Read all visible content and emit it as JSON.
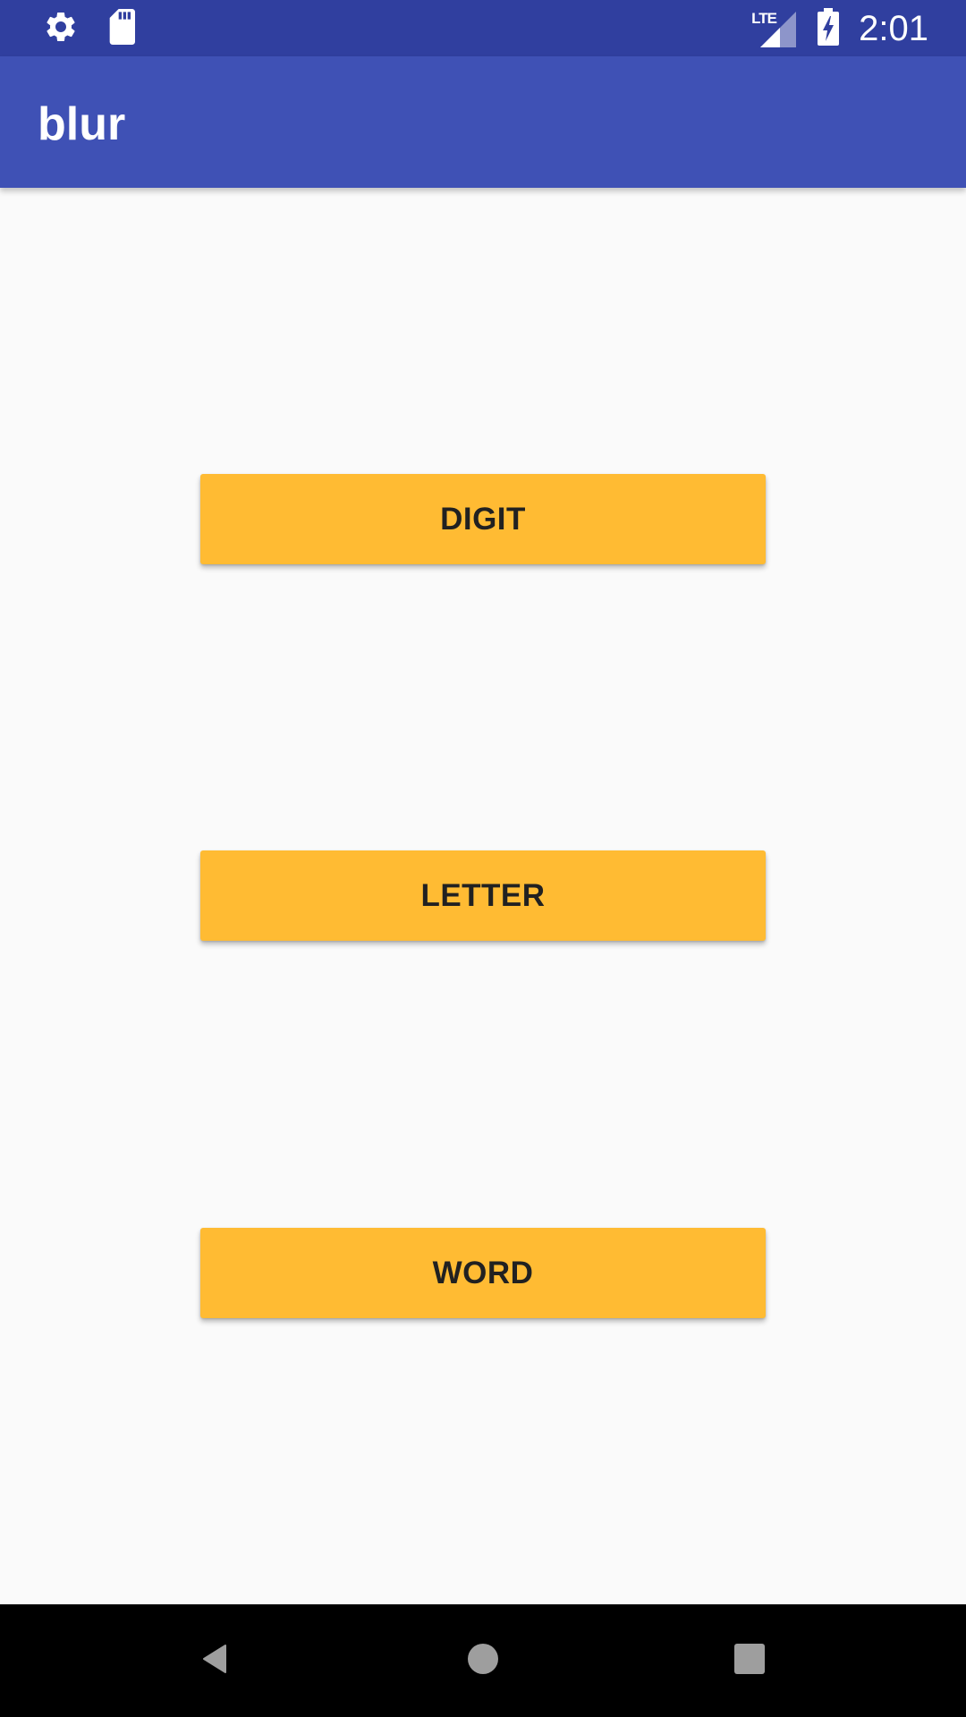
{
  "status_bar": {
    "time": "2:01",
    "network_label": "LTE",
    "background": "#303F9F",
    "icons": [
      "settings-icon",
      "sd-card-icon",
      "lte-signal-icon",
      "battery-charging-icon"
    ]
  },
  "app_bar": {
    "title": "blur",
    "background": "#3F51B5"
  },
  "buttons": {
    "digit": "DIGIT",
    "letter": "LETTER",
    "word": "WORD",
    "color": "#FFBB33"
  },
  "nav_bar": {
    "icons": [
      "back-icon",
      "home-icon",
      "recents-icon"
    ]
  }
}
